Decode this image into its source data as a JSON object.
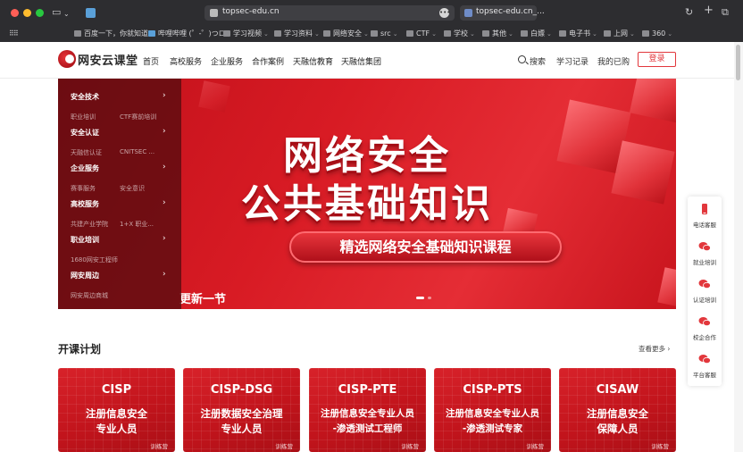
{
  "browser": {
    "url": "topsec-edu.cn",
    "tab_title": "topsec-edu.cn_...",
    "bookmarks": [
      {
        "label": "百度一下，你就知道",
        "chev": false
      },
      {
        "label": "哔哩哔哩 (゜-゜)つロ",
        "chev": false
      },
      {
        "label": "学习视频",
        "chev": true
      },
      {
        "label": "学习资料",
        "chev": true
      },
      {
        "label": "网络安全",
        "chev": true
      },
      {
        "label": "src",
        "chev": true
      },
      {
        "label": "CTF",
        "chev": true
      },
      {
        "label": "学校",
        "chev": true
      },
      {
        "label": "其他",
        "chev": true
      },
      {
        "label": "白嫖",
        "chev": true
      },
      {
        "label": "电子书",
        "chev": true
      },
      {
        "label": "上网",
        "chev": true
      },
      {
        "label": "360",
        "chev": true
      }
    ]
  },
  "header": {
    "logo": "网安云课堂",
    "nav": [
      "首页",
      "高校服务",
      "企业服务",
      "合作案例",
      "天融信教育",
      "天融信集团"
    ],
    "search": "搜索",
    "records": "学习记录",
    "mine": "我的已购",
    "login": "登录"
  },
  "hero": {
    "title_line1": "网络安全",
    "title_line2": "公共基础知识",
    "pill": "精选网络安全基础知识课程",
    "caption": "更新一节"
  },
  "sidemenu": [
    {
      "label": "安全技术",
      "subs": [
        "职业培训",
        "CTF赛前培训"
      ]
    },
    {
      "label": "安全认证",
      "subs": [
        "天融信认证",
        "CNITSEC ..."
      ]
    },
    {
      "label": "企业服务",
      "subs": [
        "赛事服务",
        "安全意识"
      ]
    },
    {
      "label": "高校服务",
      "subs": [
        "共建产业学院",
        "1+X 职业..."
      ]
    },
    {
      "label": "职业培训",
      "subs": [
        "1680网安工程师"
      ]
    },
    {
      "label": "网安周边",
      "subs": [
        "网安周边商城"
      ]
    }
  ],
  "sidepanel": [
    "电话客服",
    "就业培训",
    "认证培训",
    "校企合作",
    "平台客服"
  ],
  "section": {
    "title": "开课计划",
    "more": "查看更多"
  },
  "courses": [
    {
      "title": "CISP",
      "line1": "注册信息安全",
      "line2": "专业人员",
      "tag": "训练营"
    },
    {
      "title": "CISP-DSG",
      "line1": "注册数据安全治理",
      "line2": "专业人员",
      "tag": "训练营"
    },
    {
      "title": "CISP-PTE",
      "line1": "注册信息安全专业人员",
      "line2": "-渗透测试工程师",
      "tag": "训练营"
    },
    {
      "title": "CISP-PTS",
      "line1": "注册信息安全专业人员",
      "line2": "-渗透测试专家",
      "tag": "训练营"
    },
    {
      "title": "CISAW",
      "line1": "注册信息安全",
      "line2": "保障人员",
      "tag": "训练营"
    }
  ],
  "colors": {
    "brand_red": "#e2373c",
    "hero_red": "#d81b24",
    "chrome_dark": "#2d2d30"
  }
}
